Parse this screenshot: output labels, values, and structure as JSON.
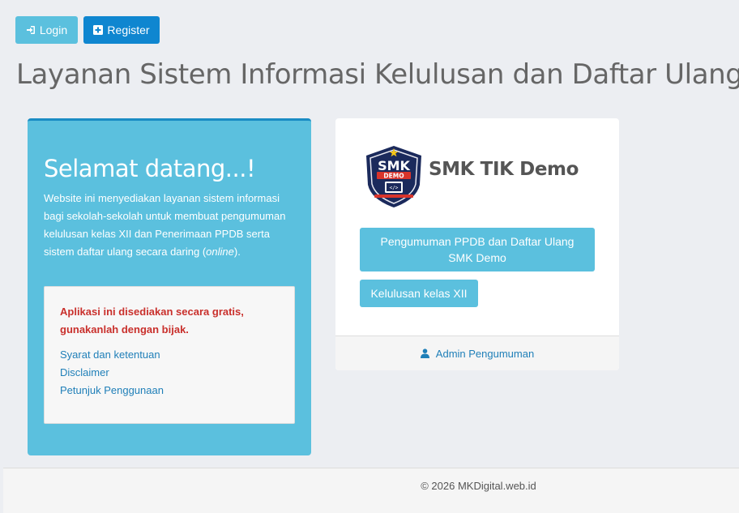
{
  "topbar": {
    "login_label": "Login",
    "register_label": "Register"
  },
  "page": {
    "title": "Layanan Sistem Informasi Kelulusan dan Daftar Ulang"
  },
  "welcome": {
    "heading": "Selamat datang...!",
    "description_pre": "Website ini menyediakan layanan sistem informasi bagi sekolah-sekolah untuk membuat pengumuman kelulusan kelas XII dan Penerimaan PPDB serta sistem daftar ulang secara daring (",
    "description_em": "online",
    "description_post": ").",
    "notice": {
      "warning": "Aplikasi ini disediakan secara gratis, gunakanlah dengan bijak.",
      "links": [
        "Syarat dan ketentuan",
        "Disclaimer",
        "Petunjuk Penggunaan"
      ]
    }
  },
  "school": {
    "logo_text": "SMK",
    "logo_subtext": "DEMO",
    "name": "SMK TIK Demo",
    "ppdb_button": "Pengumuman PPDB dan Daftar Ulang SMK Demo",
    "graduation_button": "Kelulusan kelas XII",
    "admin_link": "Admin Pengumuman"
  },
  "footer": {
    "copyright": "© 2026 MKDigital.web.id"
  },
  "colors": {
    "info": "#5bc0de",
    "primary": "#0f86d0",
    "danger": "#c9302c",
    "link": "#1f7fb8"
  },
  "icons": {
    "login": "sign-in-icon",
    "register": "plus-square-icon",
    "admin": "user-icon"
  }
}
